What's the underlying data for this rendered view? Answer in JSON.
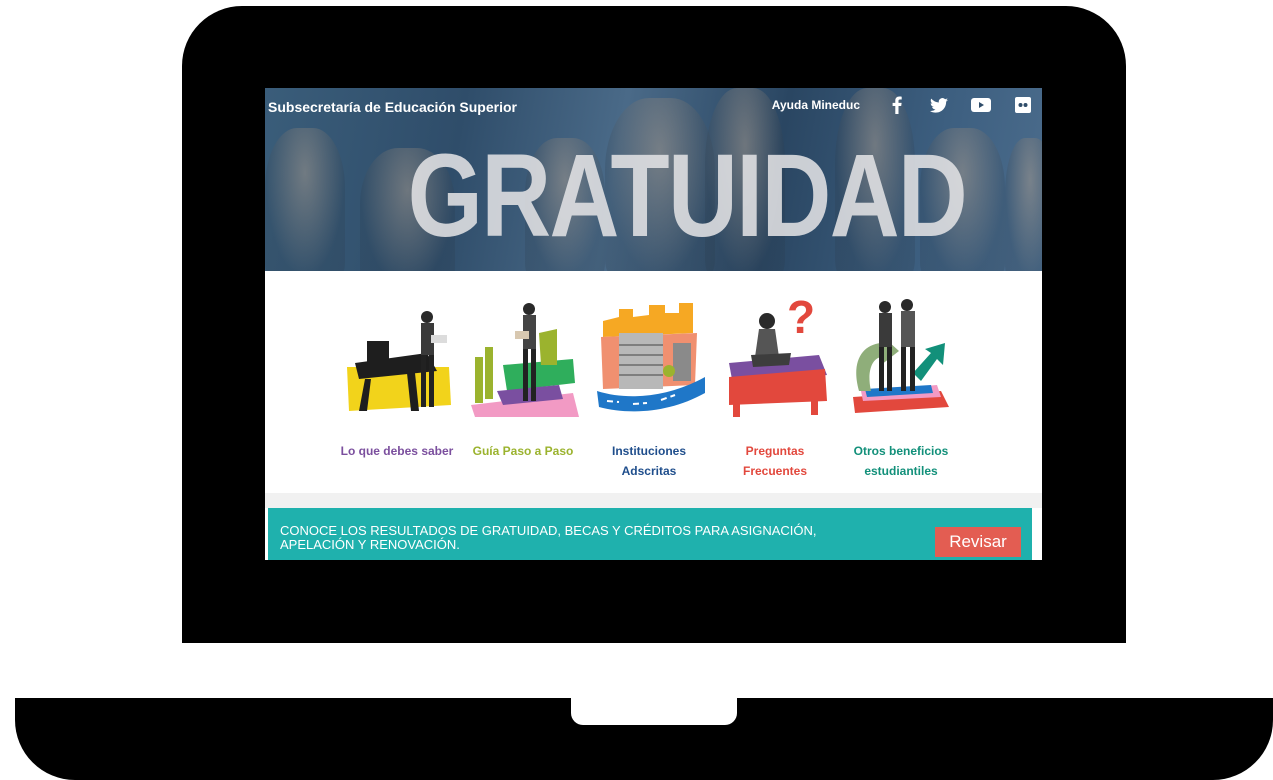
{
  "header": {
    "site_title": "Subsecretaría de Educación Superior",
    "help_link": "Ayuda Mineduc",
    "hero_word": "GRATUIDAD",
    "social": [
      "facebook-icon",
      "twitter-icon",
      "youtube-icon",
      "flickr-icon"
    ]
  },
  "menu": {
    "items": [
      {
        "label": "Lo que debes saber",
        "color": "#7b4f9e"
      },
      {
        "label": "Guía Paso a Paso",
        "color": "#9bb32e"
      },
      {
        "label": "Instituciones Adscritas",
        "color": "#1f4e8c"
      },
      {
        "label": "Preguntas Frecuentes",
        "color": "#e2483d"
      },
      {
        "label": "Otros beneficios estudiantiles",
        "color": "#12907a"
      }
    ]
  },
  "notice": {
    "text": "CONOCE LOS RESULTADOS DE GRATUIDAD, BECAS Y CRÉDITOS PARA ASIGNACIÓN, APELACIÓN Y RENOVACIÓN.",
    "button_label": "Revisar"
  },
  "colors": {
    "banner": "#2f4d6a",
    "notice_bg": "#1fb1ad",
    "button_bg": "#e35d52"
  }
}
